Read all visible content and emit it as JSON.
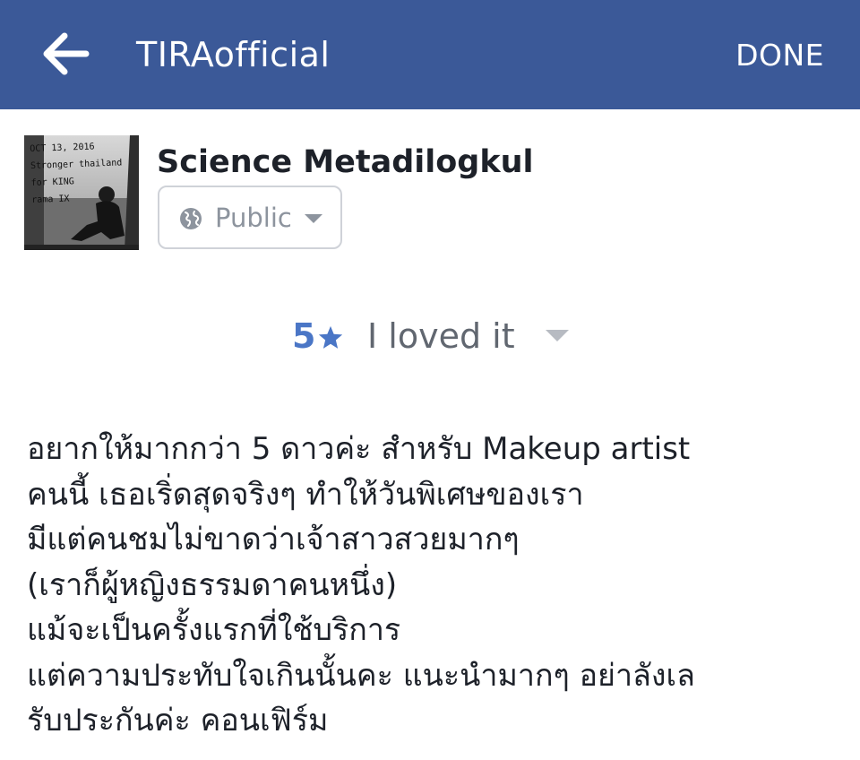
{
  "header": {
    "back_icon": "arrow-left-icon",
    "title": "TIRAofficial",
    "done_label": "DONE",
    "background_color": "#3b5998"
  },
  "author": {
    "avatar_lines": [
      "OCT 13, 2016",
      "Stronger thailand",
      "for KING",
      "rama IX"
    ],
    "name": "Science Metadilogkul",
    "privacy": {
      "icon": "globe-icon",
      "label": "Public",
      "caret_icon": "caret-down-icon"
    }
  },
  "rating": {
    "value": "5",
    "stars": 5,
    "star_icon": "star-icon",
    "label": "I loved it",
    "caret_icon": "caret-down-icon",
    "accent_color": "#4a76c6"
  },
  "review": {
    "lines": [
      "อยากให้มากกว่า 5 ดาวค่ะ สำหรับ Makeup artist",
      "คนนี้ เธอเริ่ดสุดจริงๆ ทำให้วันพิเศษของเรา",
      "มีแต่คนชมไม่ขาดว่าเจ้าสาวสวยมากๆ",
      "(เราก็ผู้หญิงธรรมดาคนหนึ่ง)",
      "แม้จะเป็นครั้งแรกที่ใช้บริการ",
      "แต่ความประทับใจเกินนั้นคะ แนะนำมากๆ อย่าลังเล",
      "รับประกันค่ะ คอนเฟิร์ม"
    ]
  }
}
